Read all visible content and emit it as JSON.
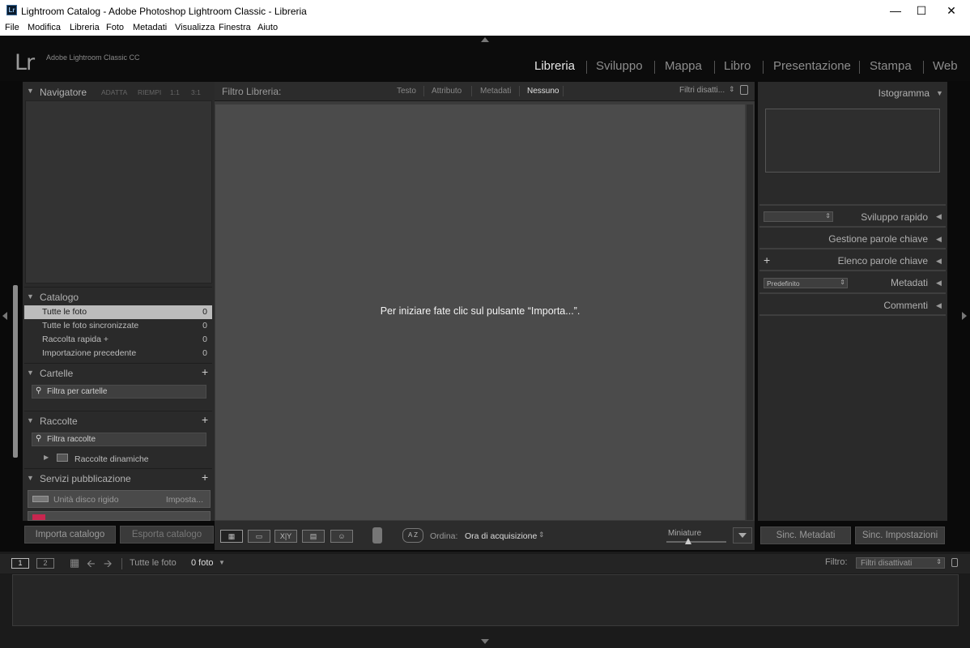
{
  "window": {
    "title": "Lightroom Catalog - Adobe Photoshop Lightroom Classic - Libreria",
    "icon": "Lr"
  },
  "menu": [
    "File",
    "Modifica",
    "Libreria",
    "Foto",
    "Metadati",
    "Visualizza",
    "Finestra",
    "Aiuto"
  ],
  "branding": {
    "logo": "Lr",
    "name": "Adobe Lightroom Classic CC"
  },
  "modules": [
    "Libreria",
    "Sviluppo",
    "Mappa",
    "Libro",
    "Presentazione",
    "Stampa",
    "Web"
  ],
  "navigator": {
    "title": "Navigatore",
    "zoom": [
      "ADATTA",
      "RIEMPI",
      "1:1",
      "3:1"
    ]
  },
  "catalog": {
    "title": "Catalogo",
    "items": [
      {
        "label": "Tutte le foto",
        "count": "0"
      },
      {
        "label": "Tutte le foto sincronizzate",
        "count": "0"
      },
      {
        "label": "Raccolta rapida +",
        "count": "0"
      },
      {
        "label": "Importazione precedente",
        "count": "0"
      }
    ]
  },
  "folders": {
    "title": "Cartelle",
    "filter_placeholder": "Filtra per cartelle"
  },
  "collections": {
    "title": "Raccolte",
    "filter_placeholder": "Filtra raccolte",
    "item": "Raccolte dinamiche"
  },
  "publish": {
    "title": "Servizi pubblicazione",
    "item": "Unità disco rigido",
    "item_action": "Imposta..."
  },
  "left_buttons": {
    "import": "Importa catalogo",
    "export": "Esporta catalogo"
  },
  "filterbar": {
    "label": "Filtro Libreria:",
    "tabs": [
      "Testo",
      "Attributo",
      "Metadati",
      "Nessuno"
    ],
    "filters": "Filtri disatti..."
  },
  "center": {
    "message": "Per iniziare fate clic sul pulsante “Importa...”."
  },
  "toolbar": {
    "sort_label": "Ordina:",
    "sort_value": "Ora di acquisizione",
    "thumbs_label": "Miniature",
    "xy": "X|Y",
    "az": "A Z"
  },
  "right_panels": {
    "histogram": "Istogramma",
    "quick_develop": "Sviluppo rapido",
    "keywording": "Gestione parole chiave",
    "keyword_list": "Elenco parole chiave",
    "metadata": "Metadati",
    "metadata_preset": "Predefinito",
    "comments": "Commenti"
  },
  "right_buttons": {
    "sync_meta": "Sinc. Metadati",
    "sync_settings": "Sinc. Impostazioni"
  },
  "filmstrip": {
    "page1": "1",
    "page2": "2",
    "source": "Tutte le foto",
    "count": "0 foto",
    "filter_label": "Filtro:",
    "filter_value": "Filtri disattivati"
  }
}
